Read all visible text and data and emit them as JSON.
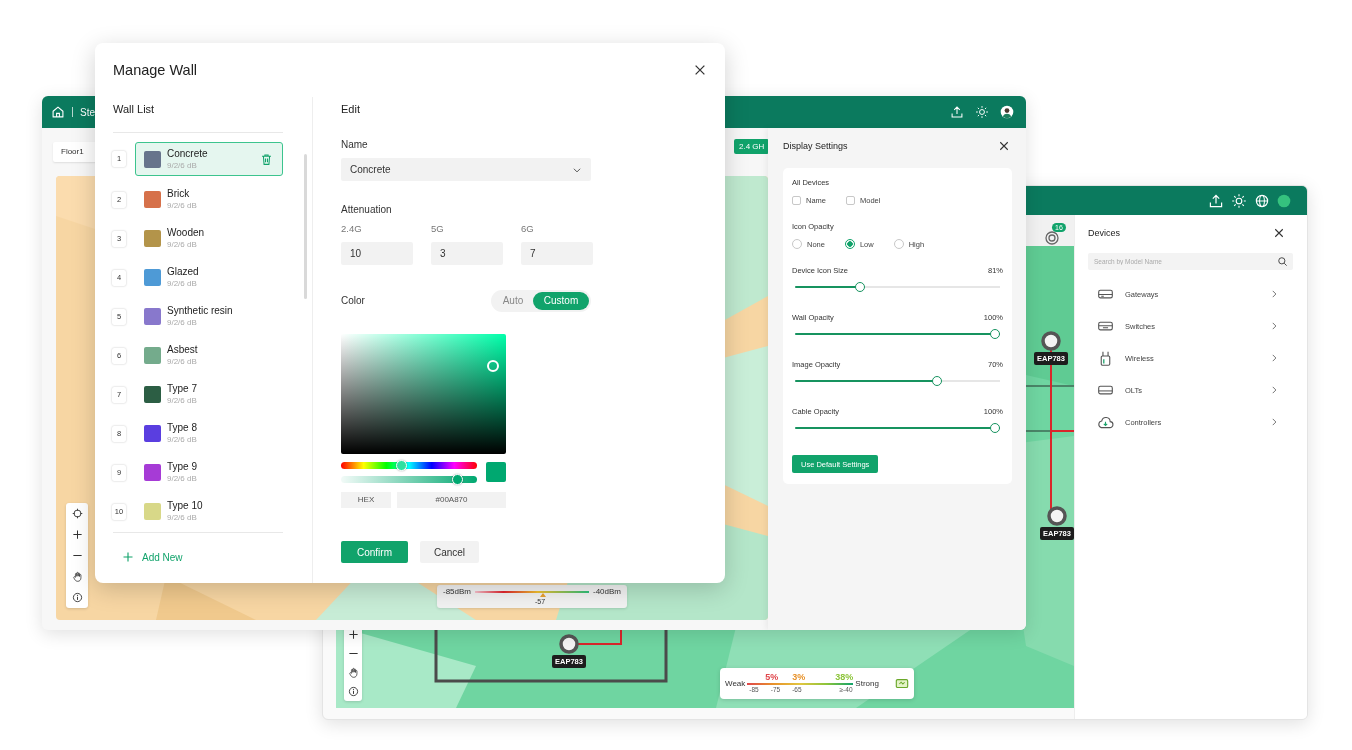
{
  "main_window": {
    "breadcrumb": "Ste",
    "floor": "Floor1",
    "band_tag": "2.4 GH",
    "signal_legend": {
      "min": "-85dBm",
      "max": "-40dBm",
      "reading": "-57",
      "level": 0.6
    }
  },
  "display_settings": {
    "title": "Display Settings",
    "all_devices": {
      "label": "All Devices",
      "options": [
        {
          "label": "Name",
          "checked": false
        },
        {
          "label": "Model",
          "checked": false
        }
      ]
    },
    "icon_opacity": {
      "label": "Icon Opacity",
      "options": [
        {
          "label": "None",
          "selected": false
        },
        {
          "label": "Low",
          "selected": true
        },
        {
          "label": "High",
          "selected": false
        }
      ]
    },
    "sliders": [
      {
        "label": "Device Icon Size",
        "reading": "81%",
        "level": 0.31
      },
      {
        "label": "Wall Opacity",
        "reading": "100%",
        "level": 1
      },
      {
        "label": "Image Opacity",
        "reading": "70%",
        "level": 0.7
      },
      {
        "label": "Cable Opacity",
        "reading": "100%",
        "level": 1
      }
    ],
    "button": "Use Default Settings"
  },
  "second_window": {
    "notification_count": "16",
    "devices_panel": {
      "title": "Devices",
      "search": {
        "placeholder": "Search by Model Name"
      },
      "categories": [
        {
          "label": "Gateways",
          "kind": "gateway"
        },
        {
          "label": "Switches",
          "kind": "switch"
        },
        {
          "label": "Wireless",
          "kind": "wireless"
        },
        {
          "label": "OLTs",
          "kind": "olt"
        },
        {
          "label": "Controllers",
          "kind": "controller"
        }
      ]
    },
    "access_points": [
      {
        "label": "EAP783"
      },
      {
        "label": "EAP783"
      },
      {
        "label": "EAP783"
      }
    ],
    "coverage_legend": {
      "weak": "Weak",
      "strong": "Strong",
      "shares": [
        {
          "text": "5%",
          "color": "#e0474c"
        },
        {
          "text": "3%",
          "color": "#e8922a"
        },
        {
          "text": "38%",
          "color": "#8cc43a"
        }
      ],
      "ticks": [
        "-85",
        "-75",
        "-65",
        "≥-40"
      ]
    }
  },
  "manage_wall": {
    "title": "Manage Wall",
    "wall_list": {
      "title": "Wall List",
      "items": [
        {
          "number": "1",
          "name": "Concrete",
          "detail": "9/2/6 dB",
          "color": "#67748c",
          "selected": true
        },
        {
          "number": "2",
          "name": "Brick",
          "detail": "9/2/6 dB",
          "color": "#d6714a",
          "selected": false
        },
        {
          "number": "3",
          "name": "Wooden",
          "detail": "9/2/6 dB",
          "color": "#b3944a",
          "selected": false
        },
        {
          "number": "4",
          "name": "Glazed",
          "detail": "9/2/6 dB",
          "color": "#4e9ad6",
          "selected": false
        },
        {
          "number": "5",
          "name": "Synthetic resin",
          "detail": "9/2/6 dB",
          "color": "#8878cc",
          "selected": false
        },
        {
          "number": "6",
          "name": "Asbest",
          "detail": "9/2/6 dB",
          "color": "#74ab8c",
          "selected": false
        },
        {
          "number": "7",
          "name": "Type 7",
          "detail": "9/2/6 dB",
          "color": "#2c5e44",
          "selected": false
        },
        {
          "number": "8",
          "name": "Type 8",
          "detail": "9/2/6 dB",
          "color": "#5a3ee0",
          "selected": false
        },
        {
          "number": "9",
          "name": "Type 9",
          "detail": "9/2/6 dB",
          "color": "#a63bd6",
          "selected": false
        },
        {
          "number": "10",
          "name": "Type 10",
          "detail": "9/2/6 dB",
          "color": "#d8d888",
          "selected": false
        }
      ],
      "add_button": "Add New"
    },
    "edit": {
      "title": "Edit",
      "name_label": "Name",
      "name_value": "Concrete",
      "attenuation_label": "Attenuation",
      "attenuation": [
        {
          "band": "2.4G",
          "value": "10"
        },
        {
          "band": "5G",
          "value": "3"
        },
        {
          "band": "6G",
          "value": "7"
        }
      ],
      "color_label": "Color",
      "color_modes": [
        {
          "label": "Auto",
          "selected": false
        },
        {
          "label": "Custom",
          "selected": true
        }
      ],
      "picker": {
        "hex": "#00A870",
        "format": "HEX",
        "alpha_slider": {
          "level": 0.85
        }
      },
      "buttons": [
        {
          "label": "Confirm",
          "kind": "primary"
        },
        {
          "label": "Cancel",
          "kind": "secondary"
        }
      ]
    }
  }
}
